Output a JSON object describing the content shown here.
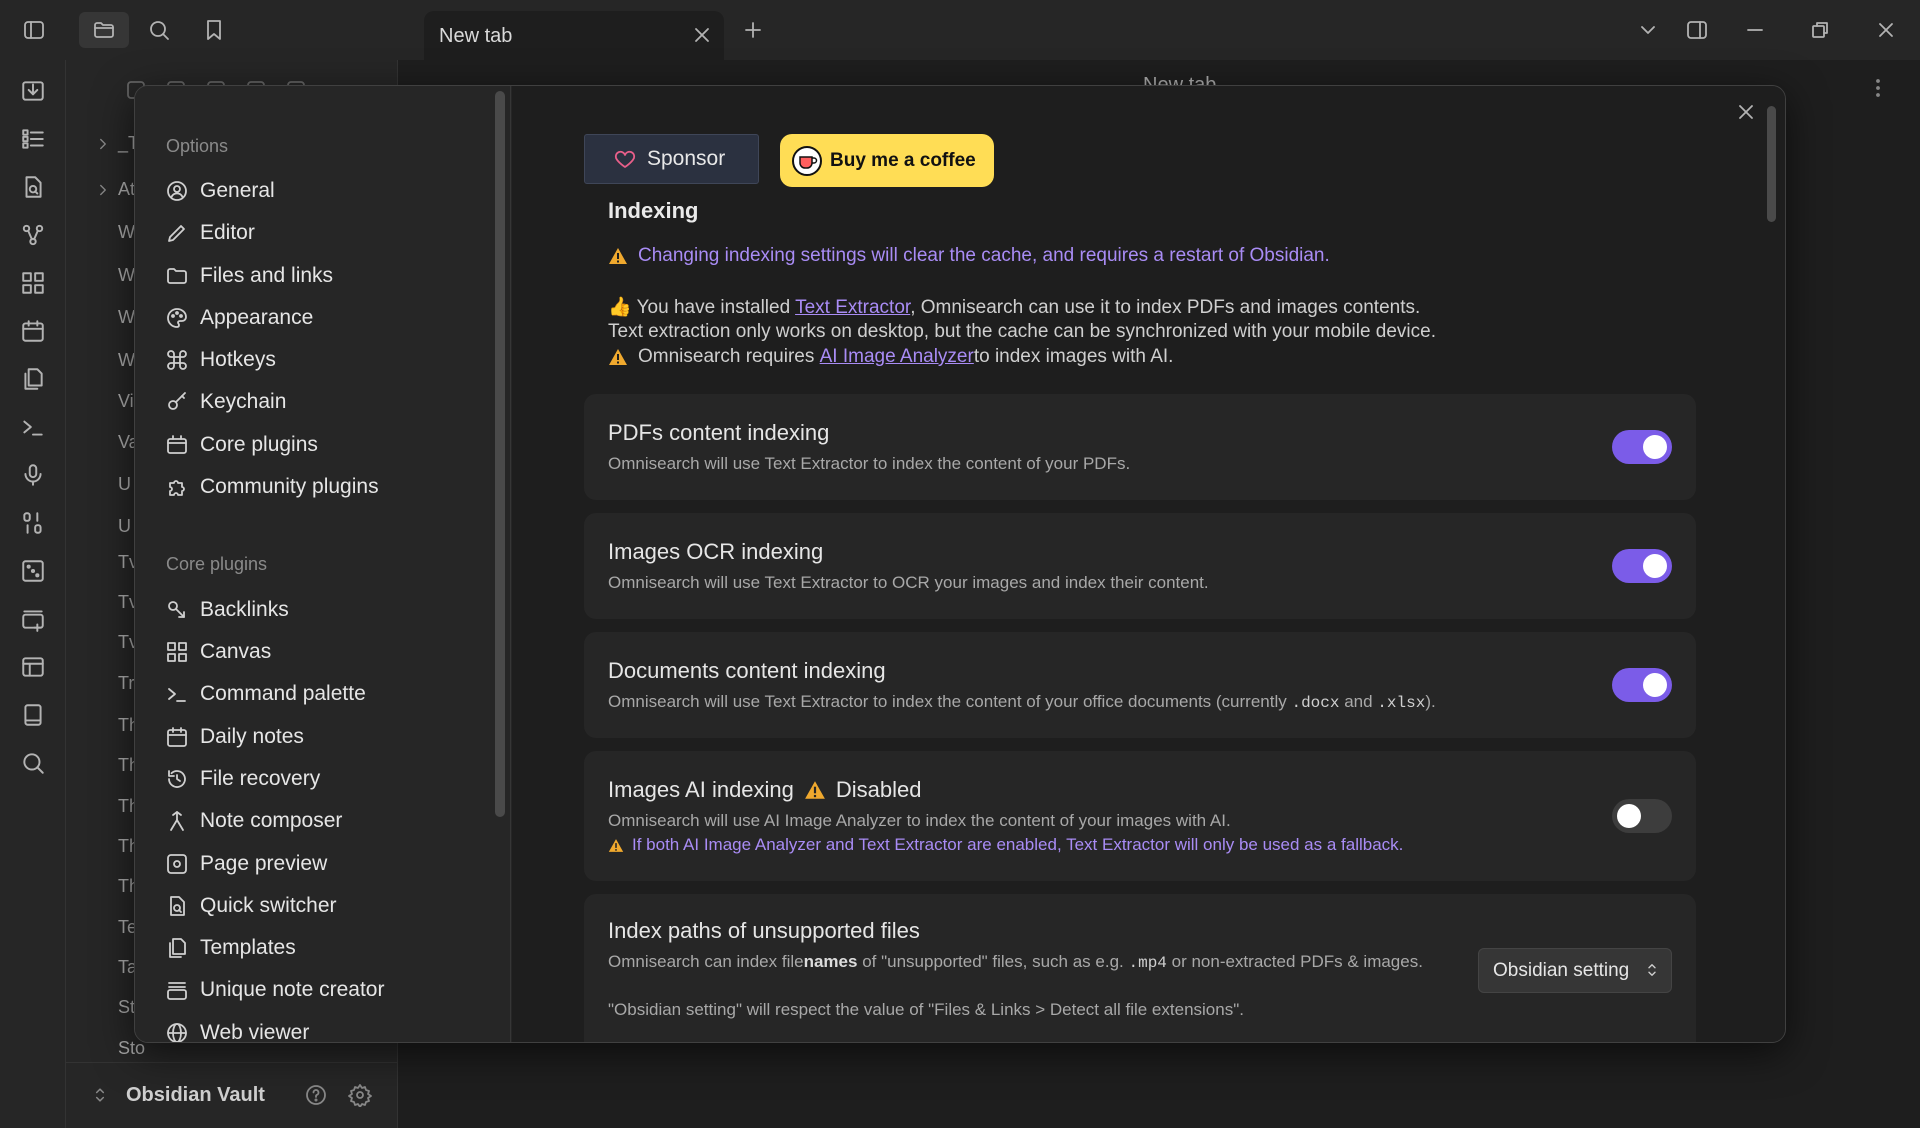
{
  "tab": {
    "label": "New tab"
  },
  "main": {
    "title": "New tab"
  },
  "explorer": {
    "rows": [
      "_T",
      "At",
      "W",
      "W",
      "W",
      "W",
      "Vi",
      "Va",
      "U",
      "U",
      "Tv",
      "Tv",
      "Tv",
      "Tr",
      "Th",
      "Th",
      "Th",
      "Th",
      "Th",
      "Te",
      "Ta",
      "St",
      "Sto"
    ],
    "vault_name": "Obsidian Vault"
  },
  "nav": {
    "options_heading": "Options",
    "options": [
      {
        "label": "General",
        "icon": "user-circle-icon"
      },
      {
        "label": "Editor",
        "icon": "pencil-icon"
      },
      {
        "label": "Files and links",
        "icon": "folder-icon"
      },
      {
        "label": "Appearance",
        "icon": "palette-icon"
      },
      {
        "label": "Hotkeys",
        "icon": "command-icon"
      },
      {
        "label": "Keychain",
        "icon": "key-icon"
      },
      {
        "label": "Core plugins",
        "icon": "plugin-icon"
      },
      {
        "label": "Community plugins",
        "icon": "puzzle-icon"
      }
    ],
    "core_heading": "Core plugins",
    "core": [
      {
        "label": "Backlinks",
        "icon": "backlink-icon"
      },
      {
        "label": "Canvas",
        "icon": "canvas-icon"
      },
      {
        "label": "Command palette",
        "icon": "terminal-icon"
      },
      {
        "label": "Daily notes",
        "icon": "calendar-icon"
      },
      {
        "label": "File recovery",
        "icon": "history-icon"
      },
      {
        "label": "Note composer",
        "icon": "merge-icon"
      },
      {
        "label": "Page preview",
        "icon": "preview-icon"
      },
      {
        "label": "Quick switcher",
        "icon": "file-search-icon"
      },
      {
        "label": "Templates",
        "icon": "files-icon"
      },
      {
        "label": "Unique note creator",
        "icon": "stack-icon"
      },
      {
        "label": "Web viewer",
        "icon": "globe-icon"
      }
    ]
  },
  "content": {
    "sponsor_label": "Sponsor",
    "coffee_label": "Buy me a coffee",
    "section_title": "Indexing",
    "warning_cache": "Changing indexing settings will clear the cache, and requires a restart of Obsidian.",
    "info1_pre": "You have installed ",
    "info1_link": "Text Extractor",
    "info1_post": ", Omnisearch can use it to index PDFs and images contents.",
    "info2": "Text extraction only works on desktop, but the cache can be synchronized with your mobile device.",
    "info3_pre": "Omnisearch requires ",
    "info3_link": "AI Image Analyzer",
    "info3_post": " to index images with AI.",
    "settings": {
      "pdf": {
        "title": "PDFs content indexing",
        "desc": "Omnisearch will use Text Extractor to index the content of your PDFs.",
        "enabled": true
      },
      "ocr": {
        "title": "Images OCR indexing",
        "desc": "Omnisearch will use Text Extractor to OCR your images and index their content.",
        "enabled": true
      },
      "docs": {
        "title": "Documents content indexing",
        "desc_pre": "Omnisearch will use Text Extractor to index the content of your office documents (currently ",
        "ext1": ".docx",
        "desc_mid": " and ",
        "ext2": ".xlsx",
        "desc_post": ").",
        "enabled": true
      },
      "ai": {
        "title": "Images AI indexing",
        "badge": "Disabled",
        "desc": "Omnisearch will use AI Image Analyzer to index the content of your images with AI.",
        "warn": "If both AI Image Analyzer and Text Extractor are enabled, Text Extractor will only be used as a fallback.",
        "enabled": false
      },
      "paths": {
        "title": "Index paths of unsupported files",
        "desc_pre": "Omnisearch can index file",
        "desc_bold": "names",
        "desc_mid": " of \"unsupported\" files, such as e.g. ",
        "ext": ".mp4",
        "desc_post": " or non-extracted PDFs & images.",
        "desc2": "\"Obsidian setting\" will respect the value of \"Files & Links > Detect all file extensions\".",
        "dropdown_value": "Obsidian setting"
      }
    }
  },
  "colors": {
    "accent": "#7b5ce8",
    "warning": "#f0a92e",
    "purple_text": "#a98cf5",
    "coffee": "#ffdd55"
  }
}
